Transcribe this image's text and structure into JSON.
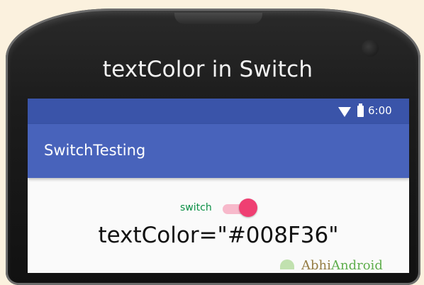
{
  "headline": "textColor in Switch",
  "status_bar": {
    "time": "6:00",
    "wifi_icon": "wifi-icon",
    "battery_icon": "battery-icon"
  },
  "app_bar": {
    "title": "SwitchTesting"
  },
  "switch": {
    "label": "switch",
    "checked": true,
    "label_color": "#008F36",
    "thumb_color": "#EF3F72"
  },
  "caption": "textColor=\"#008F36\"",
  "watermark": {
    "part1": "Abhi",
    "part2": "Android"
  },
  "colors": {
    "status_bar": "#3A54A9",
    "app_bar": "#4863BB",
    "background": "#FBF1DE"
  }
}
